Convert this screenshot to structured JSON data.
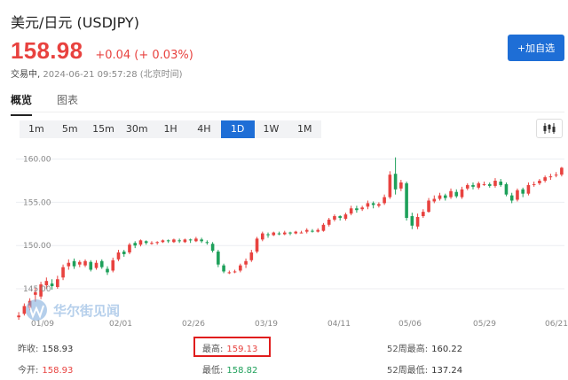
{
  "header": {
    "title": "美元/日元 (USDJPY)",
    "price": "158.98",
    "change": "+0.04 (+ 0.03%)",
    "status_state": "交易中,",
    "timestamp": "2024-06-21 09:57:28 (北京时间)",
    "add_button": "+加自选"
  },
  "tabs": [
    "概览",
    "图表"
  ],
  "periods": [
    "1m",
    "5m",
    "15m",
    "30m",
    "1H",
    "4H",
    "1D",
    "1W",
    "1M"
  ],
  "active_period": "1D",
  "chart_type_icon": "candlestick-icon",
  "watermark": "华尔街见闻",
  "colors": {
    "up": "#e8423f",
    "down": "#1ea05a",
    "accent": "#1e6ed6"
  },
  "chart_data": {
    "type": "candlestick",
    "y_ticks": [
      "160.00",
      "155.00",
      "150.00",
      "145.00"
    ],
    "x_ticks": [
      "01/09",
      "02/01",
      "02/26",
      "03/19",
      "04/11",
      "05/06",
      "05/29",
      "06/21"
    ],
    "ylim": [
      141.0,
      161.5
    ],
    "candles": [
      [
        141.7,
        141.9,
        141.4,
        142.3
      ],
      [
        142.1,
        143.0,
        141.9,
        143.3
      ],
      [
        142.8,
        143.6,
        142.5,
        143.9
      ],
      [
        144.3,
        144.6,
        143.5,
        145.1
      ],
      [
        144.1,
        145.5,
        143.8,
        145.8
      ],
      [
        145.4,
        145.9,
        145.0,
        146.3
      ],
      [
        145.6,
        145.3,
        144.9,
        146.1
      ],
      [
        145.2,
        146.1,
        145.0,
        146.5
      ],
      [
        146.3,
        147.5,
        146.0,
        147.8
      ],
      [
        147.6,
        148.0,
        147.2,
        148.4
      ],
      [
        148.2,
        147.6,
        147.3,
        148.5
      ],
      [
        147.8,
        148.1,
        147.5,
        148.3
      ],
      [
        147.7,
        148.2,
        147.5,
        148.4
      ],
      [
        148.1,
        147.2,
        147.0,
        148.3
      ],
      [
        147.4,
        148.0,
        147.2,
        148.3
      ],
      [
        148.2,
        147.5,
        147.3,
        148.4
      ],
      [
        147.3,
        146.9,
        146.6,
        147.6
      ],
      [
        147.1,
        148.3,
        146.9,
        148.6
      ],
      [
        148.4,
        149.2,
        148.2,
        149.5
      ],
      [
        149.3,
        149.0,
        148.7,
        149.5
      ],
      [
        149.2,
        150.1,
        149.0,
        150.3
      ],
      [
        150.3,
        150.0,
        149.7,
        150.5
      ],
      [
        150.1,
        150.6,
        149.9,
        150.7
      ],
      [
        150.5,
        150.3,
        150.1,
        150.6
      ],
      [
        150.2,
        150.3,
        150.1,
        150.5
      ],
      [
        150.3,
        150.4,
        150.1,
        150.5
      ],
      [
        150.4,
        150.6,
        150.3,
        150.7
      ],
      [
        150.6,
        150.5,
        150.3,
        150.7
      ],
      [
        150.4,
        150.7,
        150.3,
        150.8
      ],
      [
        150.6,
        150.5,
        150.3,
        150.8
      ],
      [
        150.4,
        150.7,
        150.3,
        150.8
      ],
      [
        150.7,
        150.6,
        150.3,
        150.8
      ],
      [
        150.5,
        150.8,
        150.4,
        151.0
      ],
      [
        150.7,
        150.5,
        150.3,
        150.9
      ],
      [
        150.4,
        150.3,
        150.1,
        150.6
      ],
      [
        150.2,
        149.4,
        149.2,
        150.4
      ],
      [
        149.3,
        147.8,
        147.5,
        149.5
      ],
      [
        147.7,
        147.0,
        146.8,
        147.9
      ],
      [
        146.9,
        146.9,
        146.7,
        147.1
      ],
      [
        146.9,
        147.0,
        146.8,
        147.2
      ],
      [
        147.1,
        147.7,
        146.9,
        147.9
      ],
      [
        147.8,
        148.2,
        147.4,
        148.5
      ],
      [
        148.3,
        149.2,
        148.1,
        149.5
      ],
      [
        149.3,
        150.8,
        149.1,
        151.0
      ],
      [
        150.7,
        151.4,
        150.5,
        151.6
      ],
      [
        151.3,
        151.2,
        150.9,
        151.5
      ],
      [
        151.2,
        151.5,
        151.1,
        151.6
      ],
      [
        151.4,
        151.3,
        151.2,
        151.6
      ],
      [
        151.3,
        151.5,
        151.2,
        151.7
      ],
      [
        151.5,
        151.4,
        151.2,
        151.6
      ],
      [
        151.4,
        151.6,
        151.3,
        151.7
      ],
      [
        151.5,
        151.5,
        151.4,
        151.7
      ],
      [
        151.6,
        151.8,
        151.4,
        152.0
      ],
      [
        151.7,
        151.6,
        151.5,
        151.9
      ],
      [
        151.6,
        151.8,
        151.5,
        152.0
      ],
      [
        151.7,
        152.4,
        151.6,
        152.6
      ],
      [
        152.4,
        153.0,
        152.2,
        153.2
      ],
      [
        153.0,
        153.4,
        152.8,
        153.6
      ],
      [
        153.4,
        153.2,
        152.9,
        153.5
      ],
      [
        153.1,
        153.6,
        152.9,
        153.8
      ],
      [
        153.7,
        154.3,
        153.5,
        154.6
      ],
      [
        154.3,
        154.1,
        153.8,
        154.6
      ],
      [
        154.2,
        154.4,
        154.0,
        154.6
      ],
      [
        154.5,
        154.9,
        154.2,
        155.2
      ],
      [
        154.9,
        154.7,
        154.3,
        155.1
      ],
      [
        154.6,
        154.8,
        154.4,
        155.0
      ],
      [
        154.9,
        155.6,
        154.7,
        155.9
      ],
      [
        155.6,
        158.2,
        155.4,
        158.6
      ],
      [
        158.3,
        156.5,
        155.9,
        160.2
      ],
      [
        156.6,
        157.3,
        156.3,
        157.6
      ],
      [
        157.2,
        153.2,
        152.9,
        157.4
      ],
      [
        153.4,
        152.3,
        151.9,
        153.8
      ],
      [
        152.2,
        153.3,
        151.9,
        153.7
      ],
      [
        153.4,
        153.9,
        153.2,
        154.2
      ],
      [
        153.9,
        155.2,
        153.8,
        155.5
      ],
      [
        155.1,
        155.4,
        154.9,
        155.8
      ],
      [
        155.4,
        155.8,
        155.2,
        156.1
      ],
      [
        155.8,
        155.5,
        155.2,
        156.0
      ],
      [
        155.6,
        156.3,
        155.4,
        156.6
      ],
      [
        156.2,
        155.7,
        155.5,
        156.5
      ],
      [
        155.6,
        156.5,
        155.4,
        156.8
      ],
      [
        156.6,
        157.0,
        156.4,
        157.2
      ],
      [
        157.0,
        156.8,
        156.5,
        157.3
      ],
      [
        156.7,
        157.2,
        156.5,
        157.4
      ],
      [
        157.1,
        157.1,
        156.9,
        157.4
      ],
      [
        157.1,
        156.9,
        156.7,
        157.3
      ],
      [
        156.9,
        157.5,
        156.7,
        157.8
      ],
      [
        157.4,
        157.0,
        156.8,
        157.7
      ],
      [
        157.1,
        155.9,
        155.7,
        157.3
      ],
      [
        155.8,
        155.2,
        154.9,
        156.1
      ],
      [
        155.3,
        156.4,
        155.1,
        156.6
      ],
      [
        156.5,
        156.0,
        155.6,
        156.7
      ],
      [
        156.0,
        157.0,
        155.8,
        157.3
      ],
      [
        157.0,
        157.1,
        156.8,
        157.4
      ],
      [
        157.2,
        157.5,
        157.0,
        157.7
      ],
      [
        157.5,
        157.9,
        157.3,
        158.1
      ],
      [
        157.9,
        158.0,
        157.6,
        158.3
      ],
      [
        158.1,
        158.2,
        157.9,
        158.5
      ],
      [
        158.2,
        159.0,
        158.0,
        159.1
      ]
    ]
  },
  "stats": {
    "prev_close_label": "昨收:",
    "prev_close": "158.93",
    "open_label": "今开:",
    "open": "158.93",
    "high_label": "最高:",
    "high": "159.13",
    "low_label": "最低:",
    "low": "158.82",
    "high52_label": "52周最高:",
    "high52": "160.22",
    "low52_label": "52周最低:",
    "low52": "137.24"
  }
}
